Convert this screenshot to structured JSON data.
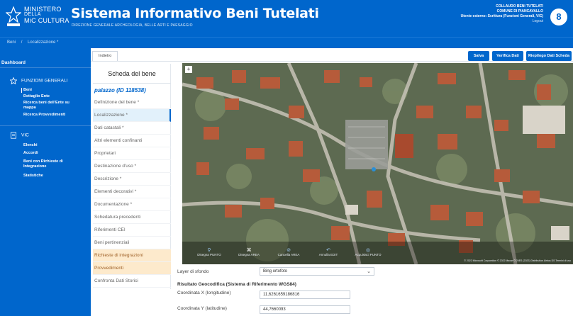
{
  "header": {
    "ministry_line1": "MINISTERO",
    "ministry_line2": "DELLA",
    "ministry_line3": "CULTURA",
    "ministry_short": "MiC",
    "app_title": "Sistema Informativo Beni Tutelati",
    "app_subtitle": "DIREZIONE GENERALE ARCHEOLOGIA, BELLE ARTI E PAESAGGIO",
    "user_role": "COLLAUDO BENI TUTELATI",
    "user_org": "COMUNE DI PIANCAVALLO",
    "user_office": "Utente esterno: Scrittura (Funzioni Generali, VIC)",
    "user_link": "Logout",
    "avatar_letter": "8"
  },
  "breadcrumb": {
    "items": [
      "Beni",
      "/",
      "Localizzazione *"
    ]
  },
  "sidebar": {
    "dashboard": "Dashboard",
    "section1": "FUNZIONI GENERALI",
    "section1_items": [
      "Beni",
      "Dettaglio Ente",
      "Ricerca beni dell'Ente su",
      "mappa",
      "Ricerca Provvedimenti"
    ],
    "section2": "VIC",
    "section2_items": [
      "Elenchi",
      "Accordi",
      "Beni con Richieste di",
      "Integrazione",
      "Statistiche"
    ]
  },
  "toolbar": {
    "tab_label": "Indietro",
    "save": "Salva",
    "verify": "Verifica Dati",
    "summary": "Riepilogo Dati Scheda"
  },
  "scheda": {
    "title": "Scheda del bene",
    "object": "palazzo (ID 118538)",
    "items": [
      {
        "label": "Definizione del bene *",
        "state": "normal"
      },
      {
        "label": "Localizzazione *",
        "state": "selected"
      },
      {
        "label": "Dati catastali *",
        "state": "normal"
      },
      {
        "label": "Altri elementi confinanti",
        "state": "normal"
      },
      {
        "label": "Proprietari",
        "state": "normal"
      },
      {
        "label": "Destinazione d'uso *",
        "state": "normal"
      },
      {
        "label": "Descrizione *",
        "state": "normal"
      },
      {
        "label": "Elementi decorativi *",
        "state": "normal"
      },
      {
        "label": "Documentazione *",
        "state": "normal"
      },
      {
        "label": "Schedatura precedenti",
        "state": "normal"
      },
      {
        "label": "Riferimenti CEI",
        "state": "normal"
      },
      {
        "label": "Beni pertinenziali",
        "state": "normal"
      },
      {
        "label": "Richieste di integrazioni",
        "state": "warn"
      },
      {
        "label": "Provvedimenti",
        "state": "warn"
      },
      {
        "label": "Confronta Dati Storici",
        "state": "normal"
      }
    ]
  },
  "map": {
    "tools": [
      {
        "label": "Disegna PUNTO",
        "icon": "pin-icon",
        "active": false
      },
      {
        "label": "Disegna AREA",
        "icon": "polygon-icon",
        "active": true
      },
      {
        "label": "Cancella AREA",
        "icon": "trash-icon",
        "active": false
      },
      {
        "label": "Annulla EDIT",
        "icon": "undo-icon",
        "active": false
      },
      {
        "label": "Acquisisci PUNTO",
        "icon": "target-icon",
        "active": false
      }
    ],
    "credit": "© 2022 Microsoft Corporation © 2022 Maxar ©CNES (2022) Distribution Airbus DS  Termini di uso",
    "zoom_label": "+"
  },
  "form": {
    "layer_label": "Layer di sfondo",
    "layer_value": "Bing ortofoto",
    "section_title": "Risultato Geocodifica (Sistema di Riferimento WGS84)",
    "x_label": "Coordinata X (longitudine)",
    "x_value": "11,6261659186816",
    "y_label": "Coordinata Y (latitudine)",
    "y_value": "44,7660093"
  }
}
